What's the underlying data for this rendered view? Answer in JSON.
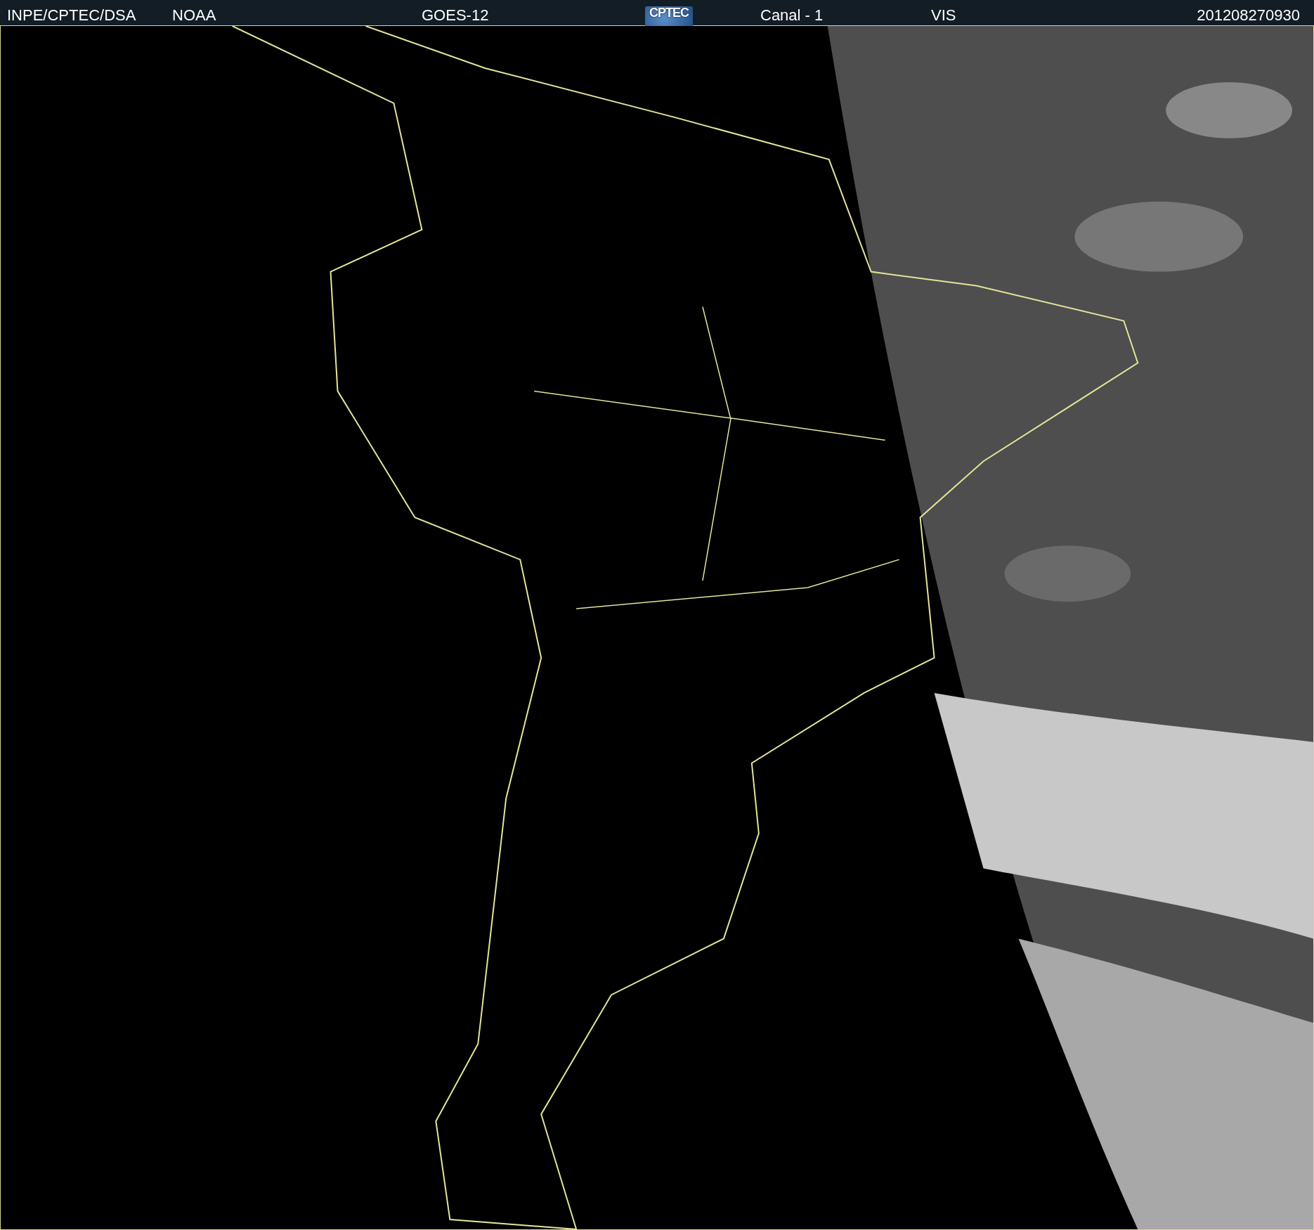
{
  "header": {
    "items": [
      "INPE/CPTEC/DSA",
      "NOAA",
      "GOES-12"
    ],
    "logo": "CPTEC",
    "items_right": [
      "Canal - 1",
      "VIS"
    ],
    "timestamp": "201208270930"
  }
}
